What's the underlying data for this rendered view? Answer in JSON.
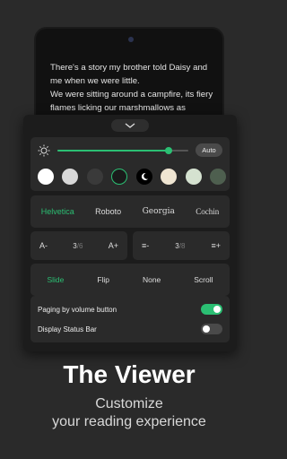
{
  "reading": {
    "line1": "There's a story my brother told Daisy and me when we were little.",
    "line2": "We were sitting around a campfire, its fiery flames licking our marshmallows as"
  },
  "brightness": {
    "level": 0.85,
    "auto_label": "Auto",
    "icon": "sun-icon"
  },
  "themes": [
    {
      "name": "white",
      "color": "#ffffff",
      "selected": false
    },
    {
      "name": "light-gray",
      "color": "#d8d8d8",
      "selected": false
    },
    {
      "name": "dark-gray",
      "color": "#3a3a3a",
      "selected": false
    },
    {
      "name": "black",
      "color": "#1a1a1a",
      "selected": true
    },
    {
      "name": "night",
      "color": "#000000",
      "selected": false,
      "icon": "moon-icon"
    },
    {
      "name": "cream",
      "color": "#efe5d2",
      "selected": false
    },
    {
      "name": "mint",
      "color": "#d5e2d0",
      "selected": false
    },
    {
      "name": "olive",
      "color": "#4e5f4f",
      "selected": false
    }
  ],
  "fonts": {
    "helvetica": "Helvetica",
    "roboto": "Roboto",
    "georgia": "Georgia",
    "cochin": "Cochin",
    "active": "Helvetica"
  },
  "font_size": {
    "decrease": "A-",
    "increase": "A+",
    "current": "3",
    "sep": "/",
    "max": "6"
  },
  "line_spacing": {
    "decrease": "≡-",
    "increase": "≡+",
    "current": "3",
    "sep": "/",
    "max": "8"
  },
  "page_modes": {
    "slide": "Slide",
    "flip": "Flip",
    "none": "None",
    "scroll": "Scroll",
    "active": "Slide"
  },
  "toggles": {
    "paging_label": "Paging by volume button",
    "paging_on": true,
    "status_bar_label": "Display Status Bar",
    "status_bar_on": false
  },
  "promo": {
    "title": "The Viewer",
    "subtitle_line1": "Customize",
    "subtitle_line2": "your reading experience"
  },
  "colors": {
    "accent": "#2bbf73",
    "background": "#2a2a2a",
    "panel": "#1c1c1c"
  }
}
